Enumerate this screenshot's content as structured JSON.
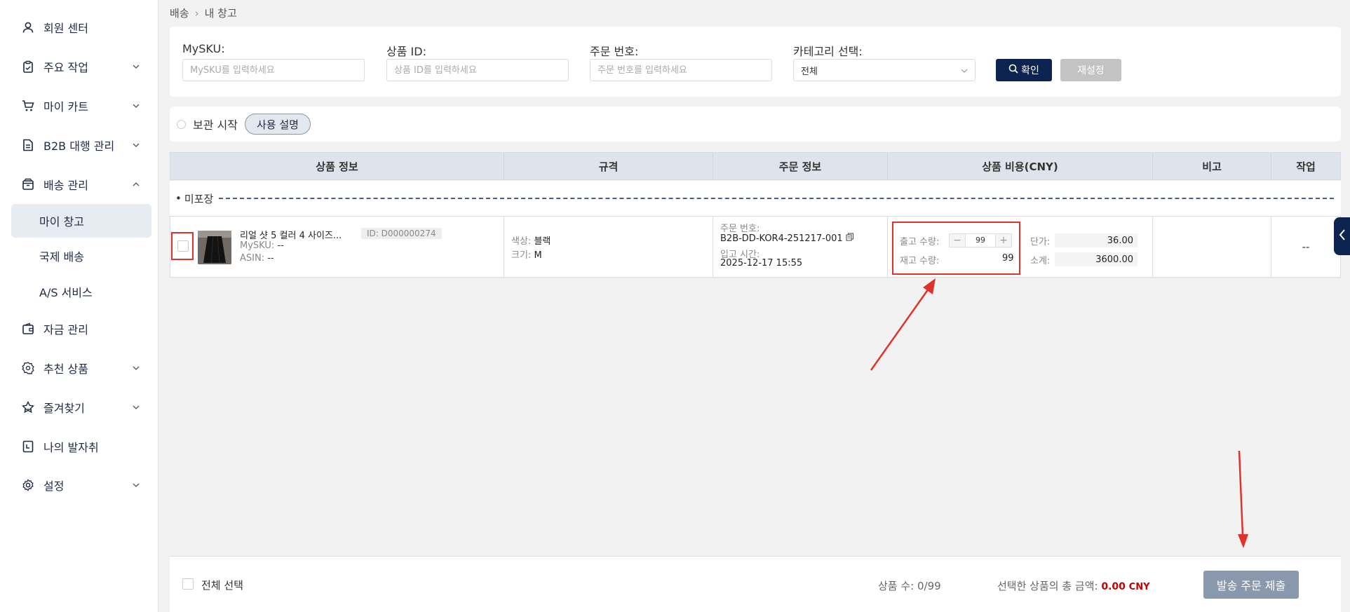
{
  "sidebar": {
    "items": [
      {
        "label": "회원 센터",
        "icon": "user-icon",
        "chevron": false
      },
      {
        "label": "주요 작업",
        "icon": "clipboard-icon",
        "chevron": true
      },
      {
        "label": "마이 카트",
        "icon": "cart-icon",
        "chevron": true
      },
      {
        "label": "B2B 대행 관리",
        "icon": "document-icon",
        "chevron": true
      },
      {
        "label": "배송 관리",
        "icon": "box-icon",
        "chevron": true
      },
      {
        "label": "자금 관리",
        "icon": "wallet-icon",
        "chevron": false
      },
      {
        "label": "추천 상품",
        "icon": "badge-icon",
        "chevron": true
      },
      {
        "label": "즐겨찾기",
        "icon": "star-icon",
        "chevron": true
      },
      {
        "label": "나의 발자취",
        "icon": "calendar-icon",
        "chevron": false
      },
      {
        "label": "설정",
        "icon": "gear-icon",
        "chevron": true
      }
    ],
    "sub_items": [
      {
        "label": "마이 창고",
        "active": true
      },
      {
        "label": "국제 배송",
        "active": false
      },
      {
        "label": "A/S 서비스",
        "active": false
      }
    ]
  },
  "breadcrumb": {
    "parent": "배송",
    "current": "내 창고"
  },
  "filters": {
    "mysku": {
      "label": "MySKU:",
      "placeholder": "MySKU를 입력하세요"
    },
    "product_id": {
      "label": "상품 ID:",
      "placeholder": "상품 ID를 입력하세요"
    },
    "order_no": {
      "label": "주문 번호:",
      "placeholder": "주문 번호를 입력하세요"
    },
    "category": {
      "label": "카테고리 선택:",
      "value": "전체"
    },
    "confirm_label": "확인",
    "reset_label": "재설정"
  },
  "bar2": {
    "start_label": "보관 시작",
    "howto_label": "사용 설명"
  },
  "table": {
    "headers": [
      "상품 정보",
      "규격",
      "주문 정보",
      "상품 비용(CNY)",
      "비고",
      "작업"
    ],
    "group_label": "미포장",
    "rows": [
      {
        "title": "리얼 샷 5 컬러 4 사이즈...",
        "id": "ID: D000000274",
        "mysku_label": "MySKU:",
        "mysku": "--",
        "asin_label": "ASIN:",
        "asin": "--",
        "color_label": "색상:",
        "color": "블랙",
        "size_label": "크기:",
        "size": "M",
        "order_no_label": "주문 번호:",
        "order_no": "B2B-DD-KOR4-251217-001",
        "in_time_label": "입고 시간:",
        "in_time": "2025-12-17 15:55",
        "out_qty_label": "출고 수량:",
        "out_qty": "99",
        "stock_qty_label": "재고 수량:",
        "stock_qty": "99",
        "unit_price_label": "단가:",
        "unit_price": "36.00",
        "subtotal_label": "소계:",
        "subtotal": "3600.00",
        "note": "",
        "action": "--"
      }
    ]
  },
  "footer": {
    "select_all_label": "전체 선택",
    "count_label": "상품 수:",
    "count_value": "0/99",
    "total_label": "선택한 상품의 총 금액:",
    "total_amount": "0.00",
    "total_currency": "CNY",
    "submit_label": "발송 주문 제출"
  },
  "colors": {
    "primary": "#0d2350",
    "highlight": "#e0322b",
    "amount": "#c40000"
  }
}
